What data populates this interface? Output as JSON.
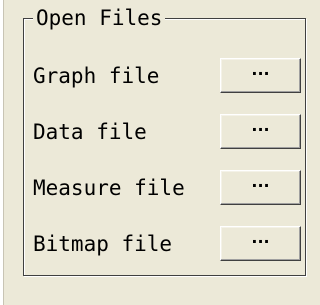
{
  "group": {
    "title": "Open Files"
  },
  "rows": [
    {
      "label": "Graph file",
      "button_label": "···"
    },
    {
      "label": "Data file",
      "button_label": "···"
    },
    {
      "label": "Measure file",
      "button_label": "···"
    },
    {
      "label": "Bitmap file",
      "button_label": "···"
    }
  ]
}
